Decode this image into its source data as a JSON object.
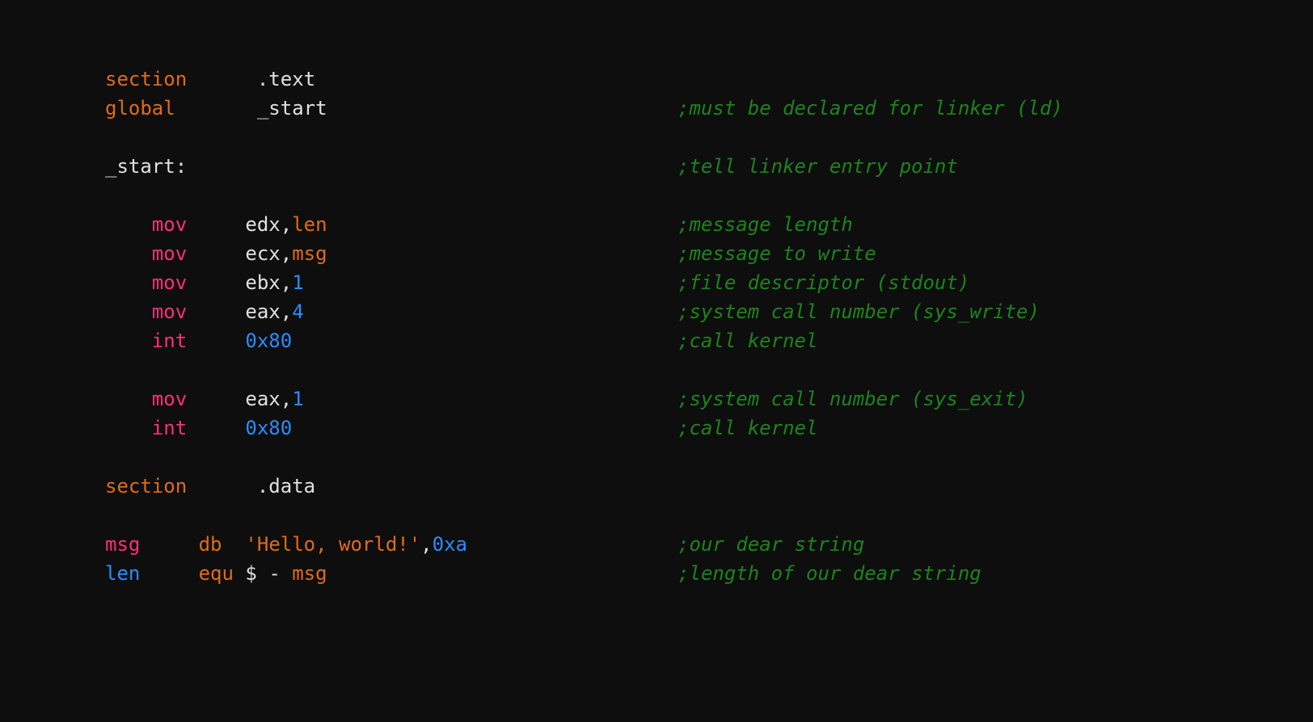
{
  "colors": {
    "background": "#0e0e0e",
    "plain": "#e0e0e0",
    "keyword": "#e06b1a",
    "instruction": "#ff2e77",
    "number": "#2a8cff",
    "string": "#e06b1a",
    "label": "#2a8cff",
    "identifier": "#e06b1a",
    "comment": "#22aa22"
  },
  "r1": {
    "kw": "section",
    "arg": ".text"
  },
  "r2": {
    "kw": "global",
    "arg": "_start",
    "c": ";must be declared for linker (ld)"
  },
  "r3": {
    "lbl": "_start:",
    "c": ";tell linker entry point"
  },
  "r4": {
    "op": "mov",
    "a1": "edx,",
    "a2": "len",
    "c": ";message length"
  },
  "r5": {
    "op": "mov",
    "a1": "ecx,",
    "a2": "msg",
    "c": ";message to write"
  },
  "r6": {
    "op": "mov",
    "a1": "ebx,",
    "a2": "1",
    "c": ";file descriptor (stdout)"
  },
  "r7": {
    "op": "mov",
    "a1": "eax,",
    "a2": "4",
    "c": ";system call number (sys_write)"
  },
  "r8": {
    "op": "int",
    "a1": "0x80",
    "c": ";call kernel"
  },
  "r9": {
    "op": "mov",
    "a1": "eax,",
    "a2": "1",
    "c": ";system call number (sys_exit)"
  },
  "r10": {
    "op": "int",
    "a1": "0x80",
    "c": ";call kernel"
  },
  "r11": {
    "kw": "section",
    "arg": ".data"
  },
  "r12": {
    "lbl": "msg",
    "kw": "db",
    "str": "'Hello, world!'",
    "comma": ",",
    "num": "0xa",
    "c": ";our dear string"
  },
  "r13": {
    "lbl": "len",
    "kw": "equ",
    "expr1": "$",
    "dash": " - ",
    "expr2": "msg",
    "c": ";length of our dear string"
  }
}
